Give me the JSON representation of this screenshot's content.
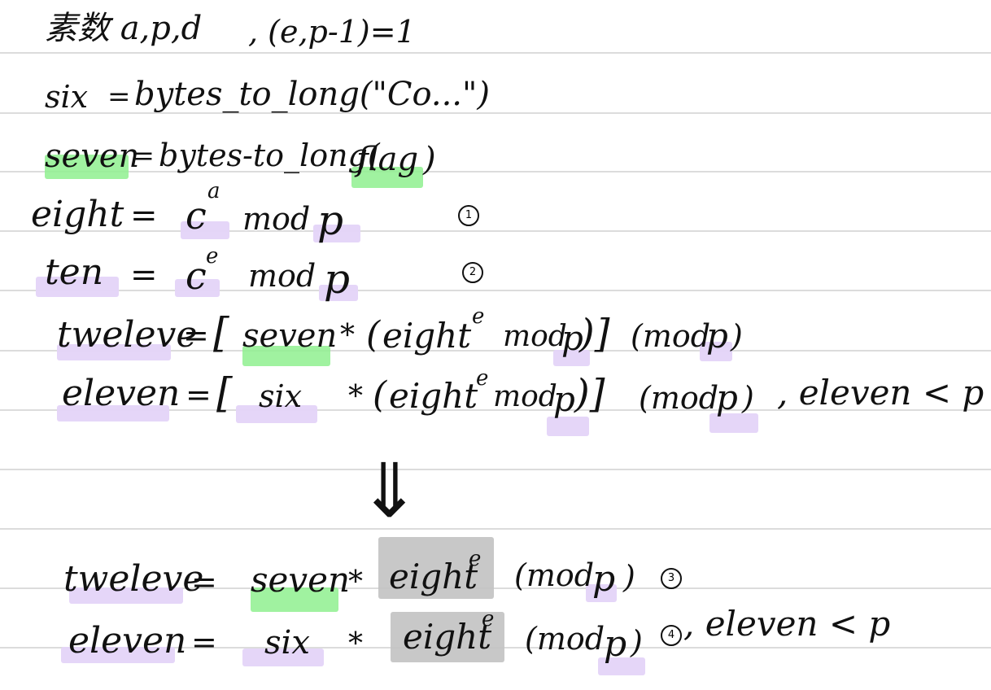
{
  "line1": {
    "left": "素数 a,p,d",
    "right": ", (e,p-1)=1"
  },
  "line2": {
    "lhs": "six",
    "eq": "=",
    "rhs": "bytes_to_long(\"Co...\")"
  },
  "line3": {
    "lhs": "seven",
    "eq": "=",
    "fn": "bytes-to_long(",
    "arg": "flag",
    "close": ")"
  },
  "eq1": {
    "lhs": "eight",
    "eq": "=",
    "base": "c",
    "exp": "a",
    "mod": "mod",
    "p": "p",
    "tag": "1"
  },
  "eq2": {
    "lhs": "ten",
    "eq": "=",
    "base": "c",
    "exp": "e",
    "mod": "mod",
    "p": "p",
    "tag": "2"
  },
  "eq3": {
    "lhs": "tweleve",
    "eq": "=",
    "open": "[",
    "a": "seven",
    "star": "*",
    "paren": "(",
    "b": "eight",
    "exp": "e",
    "mod": "mod",
    "p": "p",
    "close": ")]",
    "tail": "(mod",
    "tailp": "p",
    "tailclose": ")"
  },
  "eq4": {
    "lhs": "eleven",
    "eq": "=",
    "open": "[",
    "a": "six",
    "star": "*",
    "paren": "(",
    "b": "eight",
    "exp": "e",
    "mod": "mod",
    "p": "p",
    "close": ")]",
    "tail": "(mod",
    "tailp": "p",
    "tailclose": ")",
    "cond": ", eleven < p"
  },
  "implies": "⇓",
  "res1": {
    "lhs": "tweleve",
    "eq": "=",
    "a": "seven",
    "star": "*",
    "b": "eight",
    "exp": "e",
    "tail": "(mod",
    "p": "p",
    "close": ")",
    "tag": "3"
  },
  "res2": {
    "lhs": "eleven",
    "eq": "=",
    "a": "six",
    "star": "*",
    "b": "eight",
    "exp": "e",
    "tail": "(mod",
    "p": "p",
    "close": ")",
    "tag": "4",
    "cond": ",  eleven < p"
  },
  "colors": {
    "green": "#8ff08f",
    "purple": "#e4d4f8",
    "gray": "#c2c2c2",
    "ink": "#111111",
    "rule": "#dcdcdc"
  }
}
